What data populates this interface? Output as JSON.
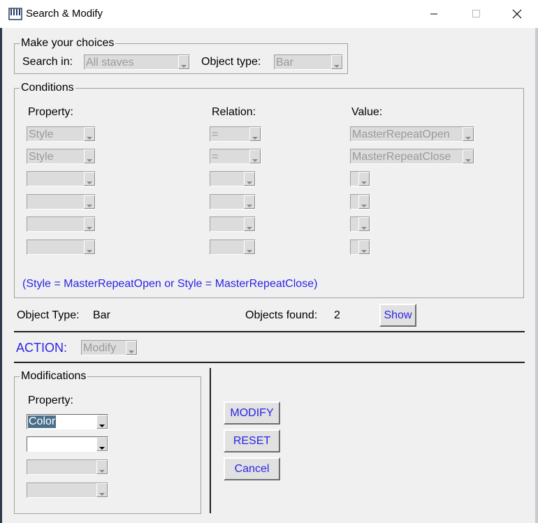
{
  "window": {
    "title": "Search & Modify",
    "app_icon": "piano-keys-icon"
  },
  "choices": {
    "legend": "Make your choices",
    "search_in_label": "Search in:",
    "search_in_value": "All staves",
    "object_type_label": "Object type:",
    "object_type_value": "Bar"
  },
  "conditions": {
    "legend": "Conditions",
    "property_header": "Property:",
    "relation_header": "Relation:",
    "value_header": "Value:",
    "rows": [
      {
        "property": "Style",
        "relation": "=",
        "value": "MasterRepeatOpen"
      },
      {
        "property": "Style",
        "relation": "=",
        "value": "MasterRepeatClose"
      },
      {
        "property": "",
        "relation": "",
        "value": ""
      },
      {
        "property": "",
        "relation": "",
        "value": ""
      },
      {
        "property": "",
        "relation": "",
        "value": ""
      },
      {
        "property": "",
        "relation": "",
        "value": ""
      }
    ],
    "expression": "(Style = MasterRepeatOpen or Style = MasterRepeatClose)"
  },
  "summary": {
    "object_type_label": "Object Type:",
    "object_type_value": "Bar",
    "objects_found_label": "Objects found:",
    "objects_found_value": "2",
    "show_label": "Show"
  },
  "action": {
    "label": "ACTION:",
    "value": "Modify"
  },
  "modifications": {
    "legend": "Modifications",
    "property_header": "Property:",
    "rows": [
      {
        "value": "Color"
      },
      {
        "value": ""
      },
      {
        "value": ""
      },
      {
        "value": ""
      }
    ]
  },
  "buttons": {
    "modify": "MODIFY",
    "reset": "RESET",
    "cancel": "Cancel"
  },
  "colors": {
    "accent_text": "#2b24e6",
    "selection": "#4a6f8a"
  }
}
